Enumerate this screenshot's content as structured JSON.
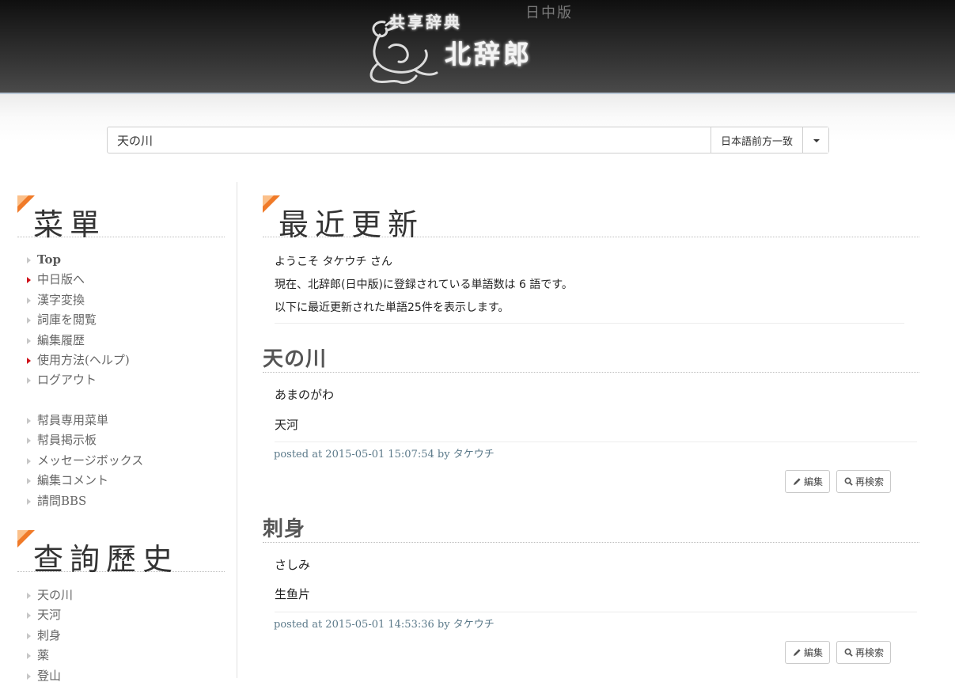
{
  "header": {
    "logo_sub": "共享辞典",
    "logo_main": "北辞郎",
    "edition": "日中版"
  },
  "search": {
    "value": "天の川",
    "mode_label": "日本語前方一致"
  },
  "sidebar": {
    "menu_title": "菜單",
    "menu_items": [
      {
        "label": "Top"
      },
      {
        "label": "中日版へ"
      },
      {
        "label": "漢字変換"
      },
      {
        "label": "詞庫を閲覧"
      },
      {
        "label": "編集履歴"
      },
      {
        "label": "使用方法(ヘルプ)"
      },
      {
        "label": "ログアウト"
      }
    ],
    "member_items": [
      {
        "label": "幇員専用菜単"
      },
      {
        "label": "幇員掲示板"
      },
      {
        "label": "メッセージボックス"
      },
      {
        "label": "編集コメント"
      },
      {
        "label": "請問BBS"
      }
    ],
    "history_title": "查詢歷史",
    "history_items": [
      {
        "label": "天の川"
      },
      {
        "label": "天河"
      },
      {
        "label": "刺身"
      },
      {
        "label": "薬"
      },
      {
        "label": "登山"
      }
    ]
  },
  "main": {
    "title": "最近更新",
    "welcome": "ようこそ タケウチ さん",
    "count_line": "現在、北辞郎(日中版)に登録されている単語数は 6 語です。",
    "recent_line": "以下に最近更新された単語25件を表示します。",
    "entries": [
      {
        "word": "天の川",
        "reading": "あまのがわ",
        "meaning": "天河",
        "posted": "posted at 2015-05-01 15:07:54 by タケウチ",
        "edit_label": "編集",
        "research_label": "再検索"
      },
      {
        "word": "刺身",
        "reading": "さしみ",
        "meaning": "生鱼片",
        "posted": "posted at 2015-05-01 14:53:36 by タケウチ",
        "edit_label": "編集",
        "research_label": "再検索"
      }
    ]
  },
  "colors": {
    "accent_orange": "#f07a28",
    "bullet_red": "#d0121b",
    "posted_text": "#5c7a8a"
  }
}
